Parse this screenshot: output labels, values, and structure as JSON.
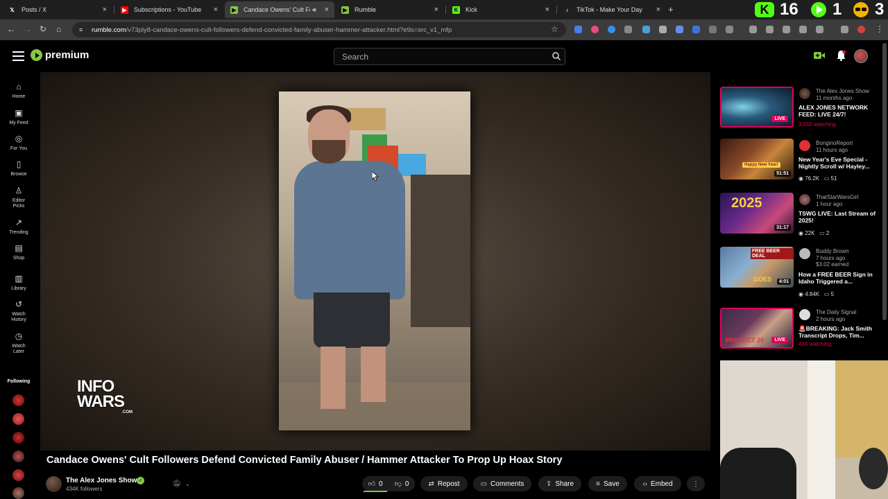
{
  "browser": {
    "tabs": [
      {
        "label": "Posts / X",
        "icon": "x-logo-icon",
        "color": "#000000"
      },
      {
        "label": "Subscriptions - YouTube",
        "icon": "youtube-icon",
        "color": "#ff0000"
      },
      {
        "label": "Candace Owens' Cult Follo",
        "icon": "rumble-icon",
        "color": "#85c742",
        "active": true
      },
      {
        "label": "Rumble",
        "icon": "rumble-icon",
        "color": "#85c742"
      },
      {
        "label": "Kick",
        "icon": "kick-icon",
        "color": "#53fc18"
      },
      {
        "label": "TikTok - Make Your Day",
        "icon": "tiktok-icon",
        "color": "#000000"
      }
    ],
    "tab_close": "×",
    "new_tab": "+",
    "ext_counter_1": "16",
    "ext_counter_2": "1",
    "ext_counter_3": "3",
    "url_host": "rumble.com",
    "url_path": "/v73ply8-candace-owens-cult-followers-defend-convicted-family-abuser-hammer-attacker.html?e9s=src_v1_mfp"
  },
  "header": {
    "logo_text": "premium",
    "search_placeholder": "Search",
    "brand_color": "#85c742"
  },
  "sidebar": {
    "items": [
      {
        "label": "Home",
        "icon": "home-icon",
        "glyph": "⌂"
      },
      {
        "label": "My Feed",
        "icon": "feed-icon",
        "glyph": "▣"
      },
      {
        "label": "For You",
        "icon": "target-icon",
        "glyph": "◎"
      },
      {
        "label": "Browse",
        "icon": "browse-icon",
        "glyph": "▯"
      },
      {
        "label": "Editor Picks",
        "icon": "award-icon",
        "glyph": "♙"
      },
      {
        "label": "Trending",
        "icon": "trending-icon",
        "glyph": "↗"
      },
      {
        "label": "Shop",
        "icon": "shop-icon",
        "glyph": "▤"
      },
      {
        "label": "Library",
        "icon": "library-icon",
        "glyph": "▥"
      },
      {
        "label": "Watch History",
        "icon": "history-icon",
        "glyph": "↺"
      },
      {
        "label": "Watch Later",
        "icon": "clock-icon",
        "glyph": "◷"
      }
    ],
    "following_label": "Following"
  },
  "video": {
    "title": "Candace Owens' Cult Followers Defend Convicted Family Abuser / Hammer Attacker To Prop Up Hoax Story",
    "watermark_line1": "INFO",
    "watermark_line2": "WARS",
    "watermark_domain": ".COM",
    "channel_name": "The Alex Jones Show",
    "channel_followers": "434K followers",
    "likes": "0",
    "dislikes": "0",
    "actions": {
      "repost": "Repost",
      "comments": "Comments",
      "share": "Share",
      "save": "Save",
      "embed": "Embed"
    }
  },
  "rail": [
    {
      "channel": "The Alex Jones Show",
      "time": "11 months ago",
      "title": "ALEX JONES NETWORK FEED: LIVE 24/7!",
      "meta": "3,555 watching",
      "badge": "LIVE",
      "live": true
    },
    {
      "channel": "BonginoReport",
      "time": "11 hours ago",
      "title": "New Year's Eve Special - Nightly Scroll w/ Hayley...",
      "views": "76.2K",
      "comments": "51",
      "badge": "51:51",
      "thumb_caption": "Happy New Year!"
    },
    {
      "channel": "ThatStarWarsGirl",
      "time": "1 hour ago",
      "title": "TSWG LIVE: Last Stream of 2025!",
      "views": "22K",
      "comments": "2",
      "badge": "31:17",
      "thumb_caption": "2025"
    },
    {
      "channel": "Buddy Brown",
      "time": "7 hours ago",
      "earned": "$3.02 earned",
      "title": "How a FREE BEER Sign in Idaho Triggered a...",
      "views": "4.84K",
      "comments": "5",
      "badge": "4:01",
      "thumb_caption": "FREE BEER DEAL",
      "thumb_caption2": "GOES"
    },
    {
      "channel": "The Daily Signal",
      "time": "2 hours ago",
      "title": "🚨BREAKING: Jack Smith Transcript Drops, Tim...",
      "meta": "414 watching",
      "badge": "LIVE",
      "live": true,
      "thumb_caption": "PROJECT 20"
    }
  ]
}
